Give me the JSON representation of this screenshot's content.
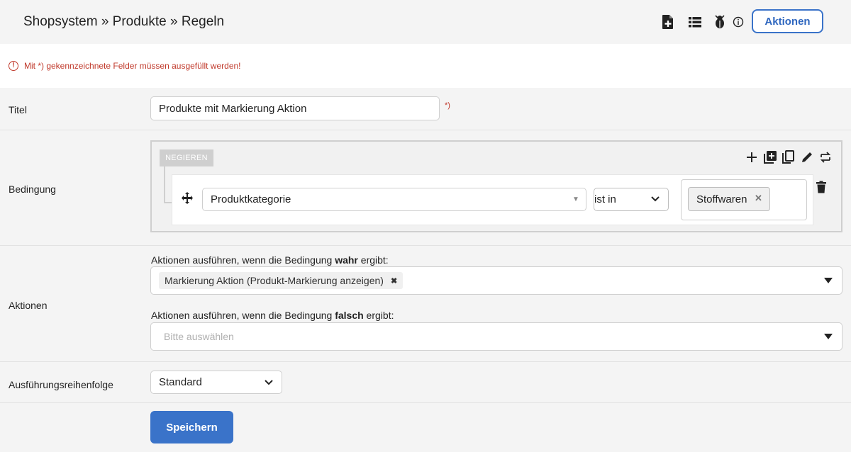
{
  "header": {
    "breadcrumb": "Shopsystem » Produkte » Regeln",
    "icons": [
      "new-document-icon",
      "list-icon",
      "bug-icon",
      "info-icon"
    ],
    "actions_label": "Aktionen"
  },
  "notice": {
    "icon": "alert-circle-icon",
    "text": "Mit *) gekennzeichnete Felder müssen ausgefüllt werden!"
  },
  "title_row": {
    "label": "Titel",
    "value": "Produkte mit Markierung Aktion",
    "required_marker": "*)"
  },
  "condition_row": {
    "label": "Bedingung",
    "negate_label": "NEGIEREN",
    "tools": [
      "plus-icon",
      "add-group-icon",
      "copy-icon",
      "pencil-icon",
      "swap-icon"
    ],
    "rule": {
      "field": "Produktkategorie",
      "operator": "ist in",
      "value_tag": "Stoffwaren"
    }
  },
  "actions_row": {
    "label": "Aktionen",
    "true_prefix": "Aktionen ausführen, wenn die Bedingung ",
    "true_bold": "wahr",
    "true_suffix": " ergibt:",
    "true_tag": "Markierung Aktion (Produkt-Markierung anzeigen)",
    "false_prefix": "Aktionen ausführen, wenn die Bedingung ",
    "false_bold": "falsch",
    "false_suffix": " ergibt:",
    "false_placeholder": "Bitte auswählen"
  },
  "order_row": {
    "label": "Ausführungsreihenfolge",
    "value": "Standard"
  },
  "save_label": "Speichern",
  "colors": {
    "accent": "#3a73c9",
    "error": "#c0392b"
  }
}
